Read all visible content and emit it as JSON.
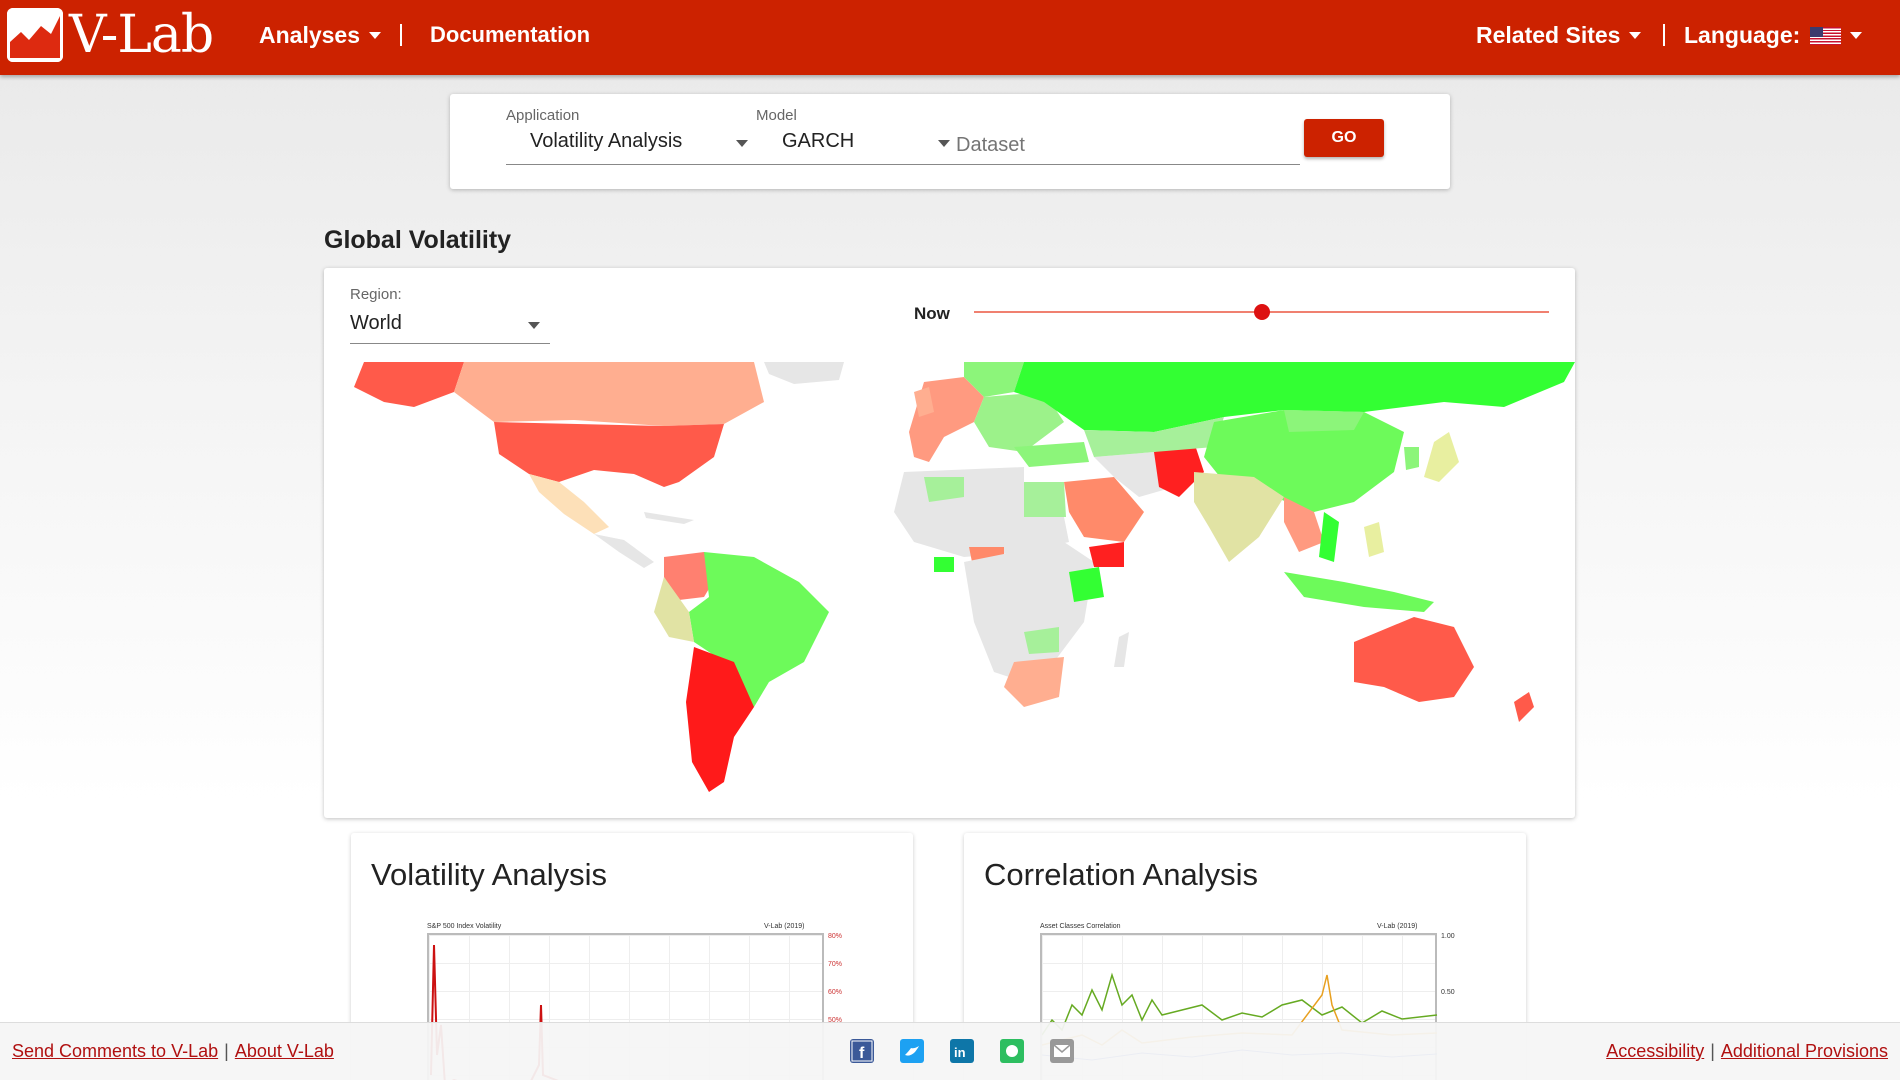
{
  "header": {
    "logo_text": "V-Lab",
    "nav": {
      "analyses": "Analyses",
      "documentation": "Documentation",
      "related_sites": "Related Sites",
      "language": "Language:"
    }
  },
  "form": {
    "application_label": "Application",
    "application_value": "Volatility Analysis",
    "model_label": "Model",
    "model_value": "GARCH",
    "dataset_placeholder": "Dataset",
    "go_label": "GO"
  },
  "global_volatility": {
    "title": "Global Volatility",
    "region_label": "Region:",
    "region_value": "World",
    "time_label": "Now",
    "slider_position": 0.5
  },
  "cards": {
    "volatility": {
      "title": "Volatility Analysis",
      "chart_title": "S&P 500 Index Volatility",
      "chart_credit": "V-Lab (2019)",
      "y_ticks": [
        "80%",
        "70%",
        "60%",
        "50%"
      ]
    },
    "correlation": {
      "title": "Correlation Analysis",
      "chart_title": "Asset Classes Correlation",
      "chart_credit": "V-Lab (2019)",
      "y_ticks": [
        "1.00",
        "0.50"
      ]
    }
  },
  "footer": {
    "send_comments": "Send Comments to V-Lab",
    "about": "About V-Lab",
    "accessibility": "Accessibility",
    "additional_provisions": "Additional Provisions",
    "social_icons": [
      "facebook-icon",
      "twitter-icon",
      "linkedin-icon",
      "evernote-icon",
      "email-icon"
    ]
  },
  "colors": {
    "brand_red": "#cc2200",
    "high_vol": "#ff2020",
    "low_vol": "#33ff33",
    "no_data": "#e6e6e6"
  }
}
